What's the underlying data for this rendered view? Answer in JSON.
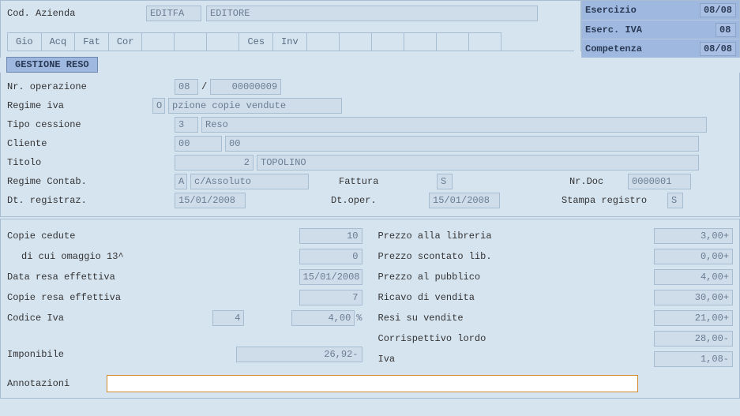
{
  "header": {
    "cod_azienda_label": "Cod. Azienda",
    "cod": "EDITFA",
    "cod_desc": "EDITORE",
    "esercizio_label": "Esercizio",
    "esercizio": "08/08",
    "eserc_iva_label": "Eserc. IVA",
    "eserc_iva": "08",
    "competenza_label": "Competenza",
    "competenza": "08/08"
  },
  "tabs": [
    "Gio",
    "Acq",
    "Fat",
    "Cor",
    "",
    "",
    "",
    "Ces",
    "Inv",
    "",
    "",
    "",
    "",
    "",
    ""
  ],
  "subtab": "GESTIONE RESO",
  "form": {
    "nr_operazione_label": "Nr. operazione",
    "nr_operazione_a": "08",
    "nr_operazione_sep": "/",
    "nr_operazione_b": "00000009",
    "regime_iva_label": "Regime iva",
    "regime_iva_code": "O",
    "regime_iva_desc": "pzione copie vendute",
    "tipo_cessione_label": "Tipo cessione",
    "tipo_cessione_code": "3",
    "tipo_cessione_desc": "Reso",
    "cliente_label": "Cliente",
    "cliente_a": "00",
    "cliente_b": "00",
    "titolo_label": "Titolo",
    "titolo_code": "2",
    "titolo_desc": "TOPOLINO",
    "regime_contab_label": "Regime Contab.",
    "regime_contab_code": "A",
    "regime_contab_desc": "c/Assoluto",
    "fattura_label": "Fattura",
    "fattura": "S",
    "nrdoc_label": "Nr.Doc",
    "nrdoc": "0000001",
    "dt_registraz_label": "Dt. registraz.",
    "dt_registraz": "15/01/2008",
    "dt_oper_label": "Dt.oper.",
    "dt_oper": "15/01/2008",
    "stampa_registro_label": "Stampa registro",
    "stampa_registro": "S"
  },
  "grid_left": {
    "copie_cedute_label": "Copie cedute",
    "copie_cedute": "10",
    "omaggio_label": "di cui omaggio 13^",
    "omaggio": "0",
    "data_resa_label": "Data resa effettiva",
    "data_resa": "15/01/2008",
    "copie_resa_label": "Copie resa effettiva",
    "copie_resa": "7",
    "codice_iva_label": "Codice Iva",
    "codice_iva_code": "4",
    "codice_iva_pct": "4,00",
    "pct_sign": "%",
    "imponibile_label": "Imponibile",
    "imponibile": "26,92-"
  },
  "grid_right": {
    "prezzo_libreria_label": "Prezzo alla libreria",
    "prezzo_libreria": "3,00+",
    "prezzo_scontato_label": "Prezzo scontato lib.",
    "prezzo_scontato": "0,00+",
    "prezzo_pubblico_label": "Prezzo al pubblico",
    "prezzo_pubblico": "4,00+",
    "ricavo_label": "Ricavo di vendita",
    "ricavo": "30,00+",
    "resi_label": "Resi su vendite",
    "resi": "21,00+",
    "corrispettivo_label": "Corrispettivo lordo",
    "corrispettivo": "28,00-",
    "iva_label": "Iva",
    "iva": "1,08-"
  },
  "annot_label": "Annotazioni",
  "annot_value": ""
}
